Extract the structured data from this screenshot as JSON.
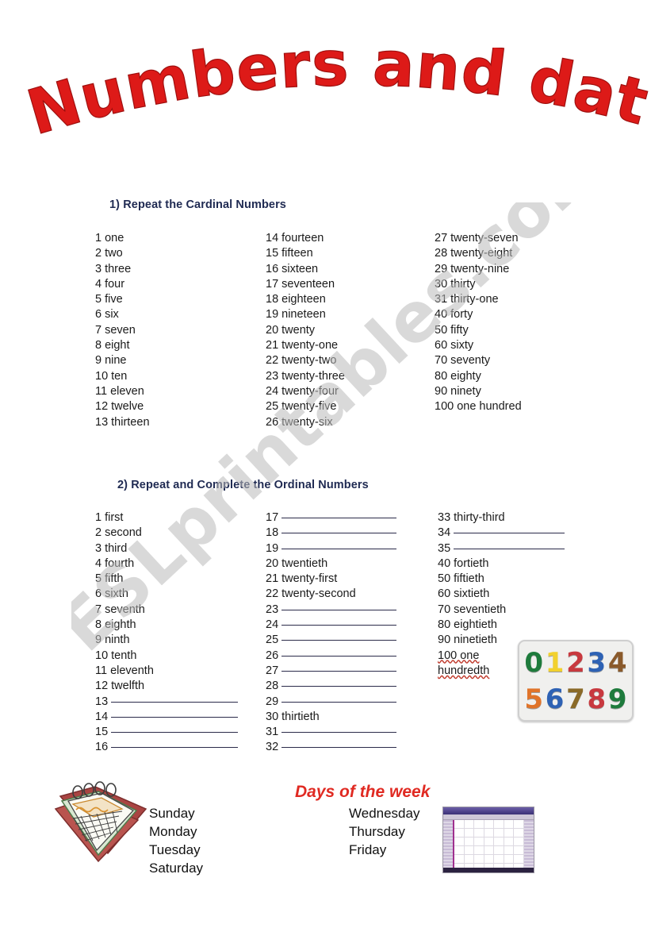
{
  "title": "Numbers and dates",
  "watermark": "ESLprintables.com",
  "sections": {
    "cardinal": {
      "heading": "1)  Repeat the Cardinal Numbers",
      "columns": [
        [
          {
            "key": "1",
            "word": "one"
          },
          {
            "key": "2",
            "word": "two"
          },
          {
            "key": "3",
            "word": "three"
          },
          {
            "key": "4",
            "word": "four"
          },
          {
            "key": "5",
            "word": "five"
          },
          {
            "key": "6",
            "word": "six"
          },
          {
            "key": "7",
            "word": "seven"
          },
          {
            "key": "8",
            "word": "eight"
          },
          {
            "key": "9",
            "word": "nine"
          },
          {
            "key": "10",
            "word": "ten"
          },
          {
            "key": "11",
            "word": "eleven"
          },
          {
            "key": "12",
            "word": "twelve"
          },
          {
            "key": "13",
            "word": "thirteen"
          }
        ],
        [
          {
            "key": "14",
            "word": "fourteen"
          },
          {
            "key": "15",
            "word": "fifteen"
          },
          {
            "key": "16",
            "word": "sixteen"
          },
          {
            "key": "17",
            "word": "seventeen"
          },
          {
            "key": "18",
            "word": "eighteen"
          },
          {
            "key": "19",
            "word": "nineteen"
          },
          {
            "key": "20",
            "word": "twenty"
          },
          {
            "key": "21",
            "word": "twenty-one"
          },
          {
            "key": "22",
            "word": "twenty-two"
          },
          {
            "key": "23",
            "word": "twenty-three"
          },
          {
            "key": "24",
            "word": "twenty-four"
          },
          {
            "key": "25",
            "word": "twenty-five"
          },
          {
            "key": "26",
            "word": "twenty-six"
          }
        ],
        [
          {
            "key": "27",
            "word": "twenty-seven"
          },
          {
            "key": "28",
            "word": "twenty-eight"
          },
          {
            "key": "29",
            "word": "twenty-nine"
          },
          {
            "key": "30",
            "word": "thirty"
          },
          {
            "key": "31",
            "word": "thirty-one"
          },
          {
            "key": "40",
            "word": "forty"
          },
          {
            "key": "50",
            "word": "fifty"
          },
          {
            "key": "60",
            "word": "sixty"
          },
          {
            "key": "70",
            "word": "seventy"
          },
          {
            "key": "80",
            "word": "eighty"
          },
          {
            "key": "90",
            "word": "ninety"
          },
          {
            "key": "100",
            "word": "one hundred"
          }
        ]
      ]
    },
    "ordinal": {
      "heading": "2)  Repeat and Complete the Ordinal Numbers",
      "columns": [
        [
          {
            "key": "1",
            "word": "first",
            "blank": false
          },
          {
            "key": "2",
            "word": "second",
            "blank": false
          },
          {
            "key": "3",
            "word": "third",
            "blank": false
          },
          {
            "key": "4",
            "word": "fourth",
            "blank": false
          },
          {
            "key": "5",
            "word": "fifth",
            "blank": false
          },
          {
            "key": "6",
            "word": "sixth",
            "blank": false
          },
          {
            "key": "7",
            "word": "seventh",
            "blank": false
          },
          {
            "key": "8",
            "word": "eighth",
            "blank": false
          },
          {
            "key": "9",
            "word": "ninth",
            "blank": false
          },
          {
            "key": "10",
            "word": "tenth",
            "blank": false
          },
          {
            "key": "11",
            "word": "eleventh",
            "blank": false
          },
          {
            "key": "12",
            "word": "twelfth",
            "blank": false
          },
          {
            "key": "13",
            "word": "",
            "blank": true
          },
          {
            "key": "14",
            "word": "",
            "blank": true
          },
          {
            "key": "15",
            "word": "",
            "blank": true
          },
          {
            "key": "16",
            "word": "",
            "blank": true
          }
        ],
        [
          {
            "key": "17",
            "word": "",
            "blank": true
          },
          {
            "key": "18",
            "word": "",
            "blank": true
          },
          {
            "key": "19",
            "word": "",
            "blank": true
          },
          {
            "key": "20",
            "word": "twentieth",
            "blank": false
          },
          {
            "key": "21",
            "word": "twenty-first",
            "blank": false
          },
          {
            "key": "22",
            "word": "twenty-second",
            "blank": false
          },
          {
            "key": "23",
            "word": "",
            "blank": true
          },
          {
            "key": "24",
            "word": "",
            "blank": true
          },
          {
            "key": "25",
            "word": "",
            "blank": true
          },
          {
            "key": "26",
            "word": "",
            "blank": true
          },
          {
            "key": "27",
            "word": "",
            "blank": true
          },
          {
            "key": "28",
            "word": "",
            "blank": true
          },
          {
            "key": "29",
            "word": "",
            "blank": true
          },
          {
            "key": "30",
            "word": "thirtieth",
            "blank": false
          },
          {
            "key": "31",
            "word": "",
            "blank": true
          },
          {
            "key": "32",
            "word": "",
            "blank": true
          }
        ],
        [
          {
            "key": "33",
            "word": "thirty-third",
            "blank": false
          },
          {
            "key": "34",
            "word": "",
            "blank": true
          },
          {
            "key": "35",
            "word": "",
            "blank": true
          },
          {
            "key": "40",
            "word": "fortieth",
            "blank": false
          },
          {
            "key": "50",
            "word": "fiftieth",
            "blank": false
          },
          {
            "key": "60",
            "word": "sixtieth",
            "blank": false
          },
          {
            "key": "70",
            "word": "seventieth",
            "blank": false
          },
          {
            "key": "80",
            "word": "eightieth",
            "blank": false
          },
          {
            "key": "90",
            "word": "ninetieth",
            "blank": false
          },
          {
            "key": "100",
            "word": "one hundredth",
            "blank": false,
            "wrap": true,
            "misspelled": true
          }
        ]
      ]
    },
    "days": {
      "title": "Days of the week",
      "left_column": [
        "Sunday",
        "Monday",
        "Tuesday",
        "Saturday"
      ],
      "right_column": [
        "Wednesday",
        "Thursday",
        "Friday"
      ]
    }
  },
  "images": {
    "number_puzzle": {
      "name": "wooden-number-puzzle-toy",
      "rows": [
        [
          {
            "digit": "0",
            "color": "#1E7B3C"
          },
          {
            "digit": "1",
            "color": "#F2D12E"
          },
          {
            "digit": "2",
            "color": "#C8393F"
          },
          {
            "digit": "3",
            "color": "#2E62B4"
          },
          {
            "digit": "4",
            "color": "#8A5A2B"
          }
        ],
        [
          {
            "digit": "5",
            "color": "#E0742A"
          },
          {
            "digit": "6",
            "color": "#2E62B4"
          },
          {
            "digit": "7",
            "color": "#8A6A28"
          },
          {
            "digit": "8",
            "color": "#C8393F"
          },
          {
            "digit": "9",
            "color": "#1E7B3C"
          }
        ]
      ]
    },
    "calendar_clipart": {
      "name": "desk-calendar-clipart"
    },
    "calendar_screenshot": {
      "name": "calendar-application-screenshot"
    }
  },
  "colors": {
    "title_red": "#DD1A18",
    "heading_navy": "#1F2A52",
    "days_title_red": "#E02A22",
    "watermark_gray": "#b9b9b9",
    "page_background": "#ffffff"
  }
}
